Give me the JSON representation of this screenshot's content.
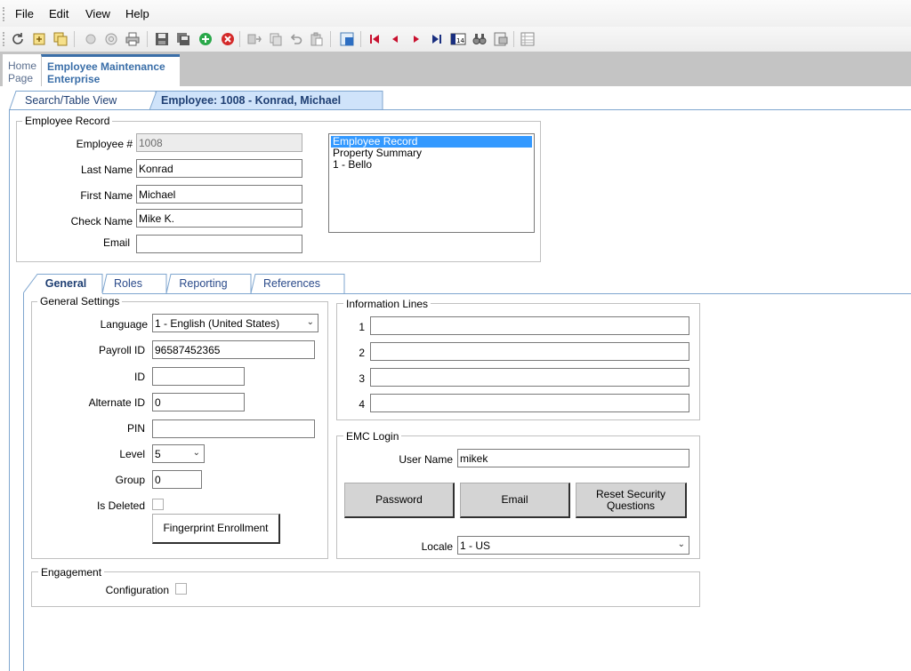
{
  "menu": {
    "file": "File",
    "edit": "Edit",
    "view": "View",
    "help": "Help"
  },
  "toolbar_icons": [
    "refresh-icon",
    "new-icon",
    "copy-record-icon",
    "disabled-circle-icon",
    "search-icon",
    "print-icon",
    "save-icon",
    "save-all-icon",
    "add-icon",
    "delete-icon",
    "move-icon",
    "duplicate-icon",
    "undo-icon",
    "paste-icon",
    "grid-icon",
    "first-record-icon",
    "previous-record-icon",
    "next-record-icon",
    "last-record-icon",
    "goto-record-icon",
    "find-icon",
    "export-icon",
    "list-view-icon"
  ],
  "module_tabs": {
    "home": "Home Page",
    "home_line1": "Home",
    "home_line2": "Page",
    "employee_line1": "Employee Maintenance",
    "employee_line2": "Enterprise"
  },
  "record_tabs": {
    "search": "Search/Table View",
    "employee": "Employee: 1008 - Konrad, Michael"
  },
  "employee_record": {
    "title": "Employee Record",
    "employee_num_label": "Employee #",
    "employee_num": "1008",
    "last_name_label": "Last Name",
    "last_name": "Konrad",
    "first_name_label": "First Name",
    "first_name": "Michael",
    "check_name_label": "Check Name",
    "check_name": "Mike K.",
    "email_label": "Email",
    "email": "",
    "list_items": [
      "Employee Record",
      "Property Summary",
      "1 - Bello"
    ]
  },
  "sub_tabs": [
    "General",
    "Roles",
    "Reporting",
    "References"
  ],
  "general_settings": {
    "title": "General Settings",
    "language_label": "Language",
    "language": "1 - English (United States)",
    "payroll_id_label": "Payroll ID",
    "payroll_id": "96587452365",
    "id_label": "ID",
    "id": "",
    "alternate_id_label": "Alternate ID",
    "alternate_id": "0",
    "pin_label": "PIN",
    "pin": "",
    "level_label": "Level",
    "level": "5",
    "group_label": "Group",
    "group": "0",
    "is_deleted_label": "Is Deleted",
    "fingerprint_button": "Fingerprint Enrollment"
  },
  "information_lines": {
    "title": "Information Lines",
    "numbers": [
      "1",
      "2",
      "3",
      "4"
    ],
    "values": [
      "",
      "",
      "",
      ""
    ]
  },
  "emc_login": {
    "title": "EMC Login",
    "user_name_label": "User Name",
    "user_name": "mikek",
    "password_button": "Password",
    "email_button": "Email",
    "reset_button_line1": "Reset Security",
    "reset_button_line2": "Questions",
    "locale_label": "Locale",
    "locale": "1 - US"
  },
  "engagement": {
    "title": "Engagement",
    "configuration_label": "Configuration"
  },
  "colors": {
    "tab_border": "#7fa6cf",
    "tab_text_active": "#1f3f73",
    "tab_text": "#2a4a8a",
    "module_strip": "#c4c4c4",
    "selection": "#3399ff"
  }
}
